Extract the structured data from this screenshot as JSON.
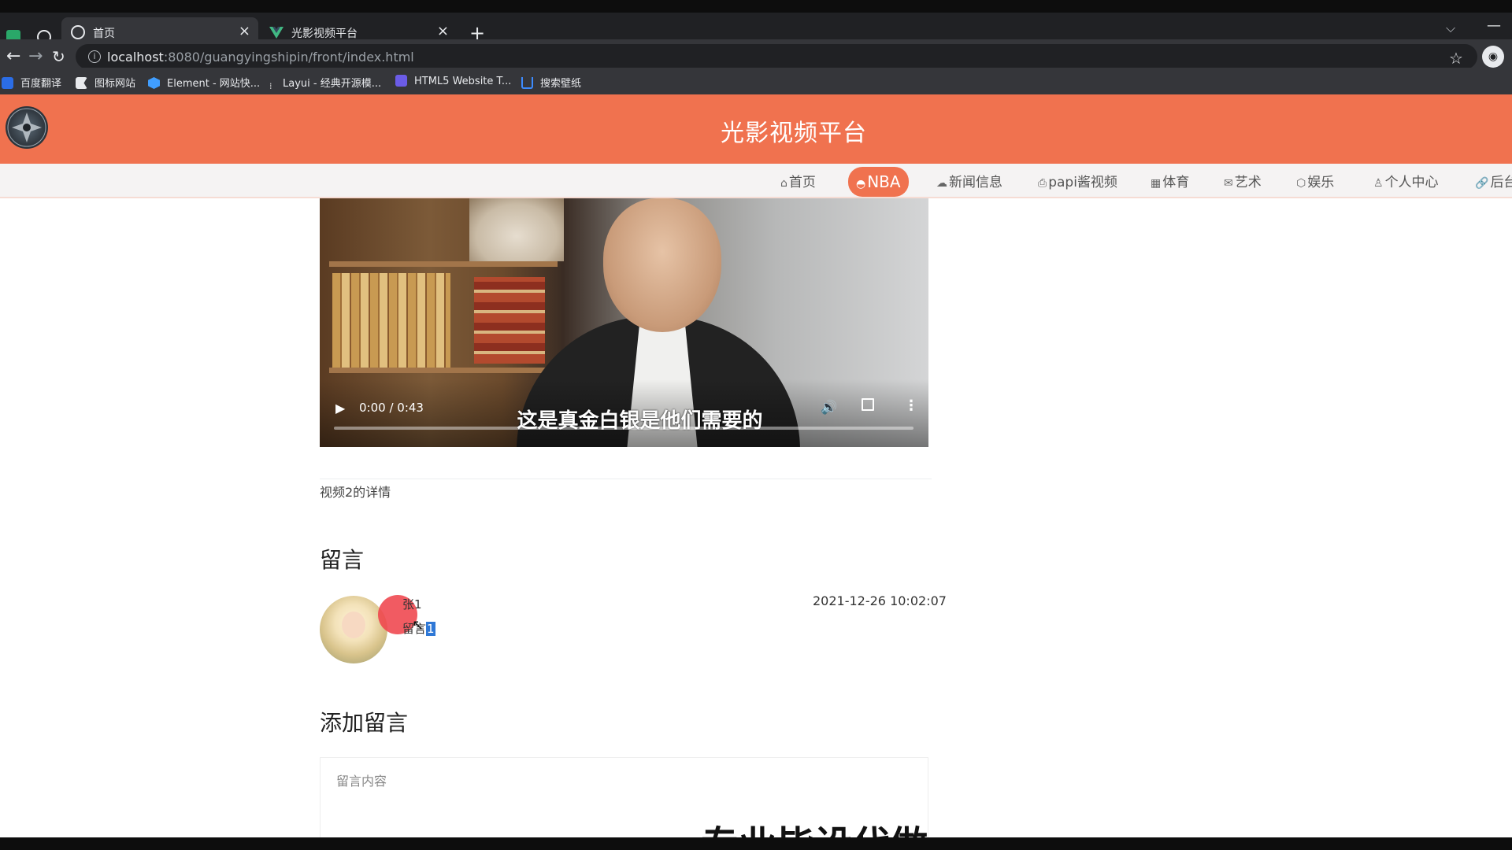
{
  "browser": {
    "tabs": [
      {
        "title": "首页",
        "favicon": "globe-icon",
        "active": true
      },
      {
        "title": "光影视频平台",
        "favicon": "vue-logo-icon",
        "active": false
      }
    ],
    "url_host": "localhost",
    "url_path": ":8080/guangyingshipin/front/index.html",
    "bookmarks": [
      {
        "label": "百度翻译",
        "icon": "baidu-translate-icon",
        "color": "#2b6de6"
      },
      {
        "label": "图标网站",
        "icon": "flag-icon",
        "color": "#e8eaed"
      },
      {
        "label": "Element - 网站快...",
        "icon": "element-icon",
        "color": "#409eff"
      },
      {
        "label": "Layui - 经典开源模...",
        "icon": "layui-icon",
        "color": "#cccccc"
      },
      {
        "label": "HTML5 Website T...",
        "icon": "html5-icon",
        "color": "#6b5ce7"
      },
      {
        "label": "搜索壁纸",
        "icon": "wallpaper-icon",
        "color": "#3d8bfd"
      }
    ]
  },
  "site": {
    "title": "光影视频平台",
    "accent_color": "#f0724f",
    "nav": [
      {
        "label": "首页",
        "icon": "home-icon",
        "active": false
      },
      {
        "label": "NBA",
        "icon": "hat-icon",
        "active": true
      },
      {
        "label": "新闻信息",
        "icon": "cloud-icon",
        "active": false
      },
      {
        "label": "papi酱视频",
        "icon": "print-icon",
        "active": false
      },
      {
        "label": "体育",
        "icon": "grid-icon",
        "active": false
      },
      {
        "label": "艺术",
        "icon": "mail-icon",
        "active": false
      },
      {
        "label": "娱乐",
        "icon": "cube-icon",
        "active": false
      },
      {
        "label": "个人中心",
        "icon": "user-icon",
        "active": false
      },
      {
        "label": "后台",
        "icon": "link-icon",
        "active": false
      }
    ]
  },
  "video": {
    "time": "0:00 / 0:43",
    "subtitle": "这是真金白银是他们需要的",
    "progress": 0
  },
  "detail": {
    "text": "视频2的详情"
  },
  "comments": {
    "heading": "留言",
    "items": [
      {
        "user": "张1",
        "text_prefix": "留言",
        "text_selected": "1",
        "time": "2021-12-26 10:02:07"
      }
    ]
  },
  "add_comment": {
    "heading": "添加留言",
    "placeholder": "留言内容"
  },
  "overlay_caption": "专业毕设代做"
}
